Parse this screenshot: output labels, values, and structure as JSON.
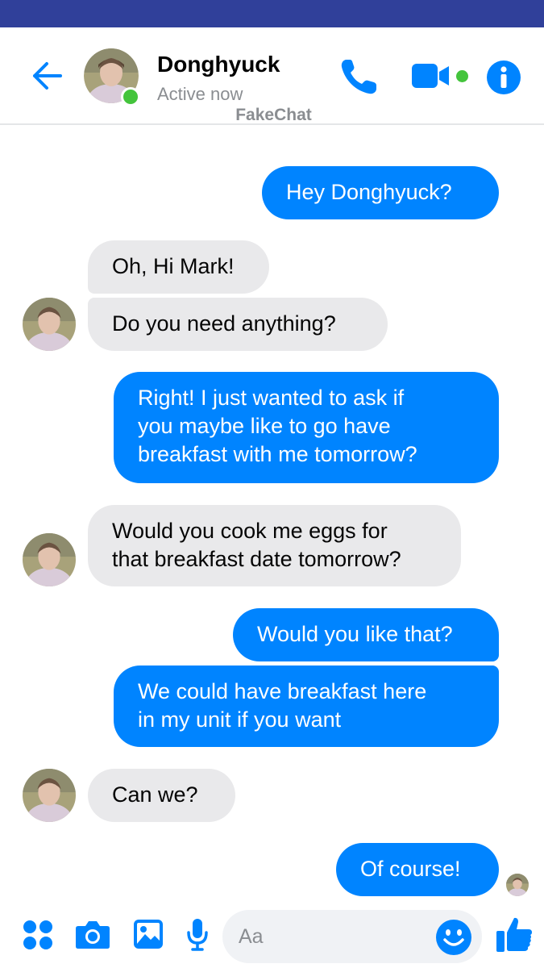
{
  "header": {
    "contact_name": "Donghyuck",
    "presence": "Active now",
    "watermark": "FakeChat"
  },
  "messages": [
    {
      "side": "sent",
      "text": "Hey Donghyuck?"
    },
    {
      "side": "received",
      "text": "Oh, Hi Mark!"
    },
    {
      "side": "received",
      "text": "Do you need anything?"
    },
    {
      "side": "sent",
      "text": "Right!  I just wanted to ask if\nyou maybe like to go have\nbreakfast with me tomorrow?"
    },
    {
      "side": "received",
      "text": "Would you cook me eggs for\nthat breakfast date tomorrow?"
    },
    {
      "side": "sent",
      "text": "Would you like that?"
    },
    {
      "side": "sent",
      "text": "We could have breakfast here\nin my unit if you want"
    },
    {
      "side": "received",
      "text": "Can we?"
    },
    {
      "side": "sent",
      "text": "Of course!"
    }
  ],
  "composer": {
    "placeholder": "Aa"
  },
  "icons": {
    "back": "arrow-left-icon",
    "call": "phone-icon",
    "video": "video-camera-icon",
    "info": "info-icon",
    "menu": "four-dots-icon",
    "camera": "camera-icon",
    "gallery": "image-icon",
    "mic": "microphone-icon",
    "emoji": "emoji-icon",
    "like": "thumbs-up-icon"
  },
  "colors": {
    "accent": "#0084ff",
    "status_bar": "#30409a",
    "received_bubble": "#e9e9eb",
    "online": "#44c43c"
  }
}
